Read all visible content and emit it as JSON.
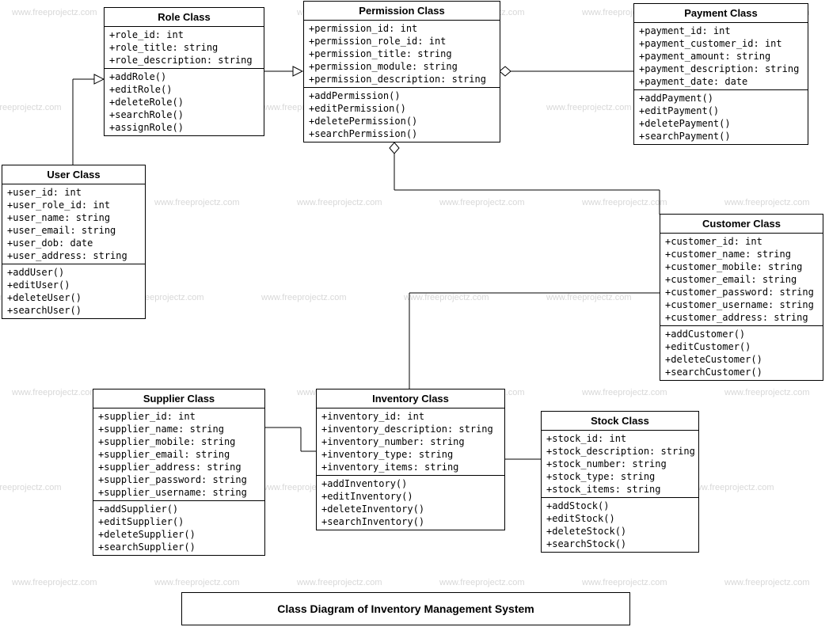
{
  "watermark_text": "www.freeprojectz.com",
  "caption": "Class Diagram of Inventory Management System",
  "classes": {
    "role": {
      "title": "Role Class",
      "attrs": [
        "+role_id: int",
        "+role_title: string",
        "+role_description: string"
      ],
      "ops": [
        "+addRole()",
        "+editRole()",
        "+deleteRole()",
        "+searchRole()",
        "+assignRole()"
      ]
    },
    "permission": {
      "title": "Permission Class",
      "attrs": [
        "+permission_id: int",
        "+permission_role_id: int",
        "+permission_title: string",
        "+permission_module: string",
        "+permission_description: string"
      ],
      "ops": [
        "+addPermission()",
        "+editPermission()",
        "+deletePermission()",
        "+searchPermission()"
      ]
    },
    "payment": {
      "title": "Payment Class",
      "attrs": [
        "+payment_id: int",
        "+payment_customer_id: int",
        "+payment_amount: string",
        "+payment_description: string",
        "+payment_date: date"
      ],
      "ops": [
        "+addPayment()",
        "+editPayment()",
        "+deletePayment()",
        "+searchPayment()"
      ]
    },
    "user": {
      "title": "User Class",
      "attrs": [
        "+user_id: int",
        "+user_role_id: int",
        "+user_name: string",
        "+user_email: string",
        "+user_dob: date",
        "+user_address: string"
      ],
      "ops": [
        "+addUser()",
        "+editUser()",
        "+deleteUser()",
        "+searchUser()"
      ]
    },
    "customer": {
      "title": "Customer Class",
      "attrs": [
        "+customer_id: int",
        "+customer_name: string",
        "+customer_mobile: string",
        "+customer_email: string",
        "+customer_password: string",
        "+customer_username: string",
        "+customer_address: string"
      ],
      "ops": [
        "+addCustomer()",
        "+editCustomer()",
        "+deleteCustomer()",
        "+searchCustomer()"
      ]
    },
    "supplier": {
      "title": "Supplier Class",
      "attrs": [
        "+supplier_id: int",
        "+supplier_name: string",
        "+supplier_mobile: string",
        "+supplier_email: string",
        "+supplier_address: string",
        "+supplier_password: string",
        "+supplier_username: string"
      ],
      "ops": [
        "+addSupplier()",
        "+editSupplier()",
        "+deleteSupplier()",
        "+searchSupplier()"
      ]
    },
    "inventory": {
      "title": "Inventory Class",
      "attrs": [
        "+inventory_id: int",
        "+inventory_description: string",
        "+inventory_number: string",
        "+inventory_type: string",
        "+inventory_items: string"
      ],
      "ops": [
        "+addInventory()",
        "+editInventory()",
        "+deleteInventory()",
        "+searchInventory()"
      ]
    },
    "stock": {
      "title": "Stock Class",
      "attrs": [
        "+stock_id: int",
        "+stock_description: string",
        "+stock_number: string",
        "+stock_type: string",
        "+stock_items: string"
      ],
      "ops": [
        "+addStock()",
        "+editStock()",
        "+deleteStock()",
        "+searchStock()"
      ]
    }
  },
  "chart_data": {
    "type": "uml_class_diagram",
    "title": "Class Diagram of Inventory Management System",
    "classes": [
      {
        "name": "Role Class",
        "attributes": [
          "role_id: int",
          "role_title: string",
          "role_description: string"
        ],
        "operations": [
          "addRole()",
          "editRole()",
          "deleteRole()",
          "searchRole()",
          "assignRole()"
        ]
      },
      {
        "name": "Permission Class",
        "attributes": [
          "permission_id: int",
          "permission_role_id: int",
          "permission_title: string",
          "permission_module: string",
          "permission_description: string"
        ],
        "operations": [
          "addPermission()",
          "editPermission()",
          "deletePermission()",
          "searchPermission()"
        ]
      },
      {
        "name": "Payment Class",
        "attributes": [
          "payment_id: int",
          "payment_customer_id: int",
          "payment_amount: string",
          "payment_description: string",
          "payment_date: date"
        ],
        "operations": [
          "addPayment()",
          "editPayment()",
          "deletePayment()",
          "searchPayment()"
        ]
      },
      {
        "name": "User Class",
        "attributes": [
          "user_id: int",
          "user_role_id: int",
          "user_name: string",
          "user_email: string",
          "user_dob: date",
          "user_address: string"
        ],
        "operations": [
          "addUser()",
          "editUser()",
          "deleteUser()",
          "searchUser()"
        ]
      },
      {
        "name": "Customer Class",
        "attributes": [
          "customer_id: int",
          "customer_name: string",
          "customer_mobile: string",
          "customer_email: string",
          "customer_password: string",
          "customer_username: string",
          "customer_address: string"
        ],
        "operations": [
          "addCustomer()",
          "editCustomer()",
          "deleteCustomer()",
          "searchCustomer()"
        ]
      },
      {
        "name": "Supplier Class",
        "attributes": [
          "supplier_id: int",
          "supplier_name: string",
          "supplier_mobile: string",
          "supplier_email: string",
          "supplier_address: string",
          "supplier_password: string",
          "supplier_username: string"
        ],
        "operations": [
          "addSupplier()",
          "editSupplier()",
          "deleteSupplier()",
          "searchSupplier()"
        ]
      },
      {
        "name": "Inventory Class",
        "attributes": [
          "inventory_id: int",
          "inventory_description: string",
          "inventory_number: string",
          "inventory_type: string",
          "inventory_items: string"
        ],
        "operations": [
          "addInventory()",
          "editInventory()",
          "deleteInventory()",
          "searchInventory()"
        ]
      },
      {
        "name": "Stock Class",
        "attributes": [
          "stock_id: int",
          "stock_description: string",
          "stock_number: string",
          "stock_type: string",
          "stock_items: string"
        ],
        "operations": [
          "addStock()",
          "editStock()",
          "deleteStock()",
          "searchStock()"
        ]
      }
    ],
    "relationships": [
      {
        "from": "User Class",
        "to": "Role Class",
        "type": "generalization"
      },
      {
        "from": "Role Class",
        "to": "Permission Class",
        "type": "generalization"
      },
      {
        "from": "Permission Class",
        "to": "Payment Class",
        "type": "aggregation"
      },
      {
        "from": "Permission Class",
        "to": "Customer Class",
        "type": "aggregation"
      },
      {
        "from": "Inventory Class",
        "to": "Supplier Class",
        "type": "association"
      },
      {
        "from": "Inventory Class",
        "to": "Stock Class",
        "type": "association"
      },
      {
        "from": "Inventory Class",
        "to": "Customer Class",
        "type": "association"
      }
    ]
  }
}
